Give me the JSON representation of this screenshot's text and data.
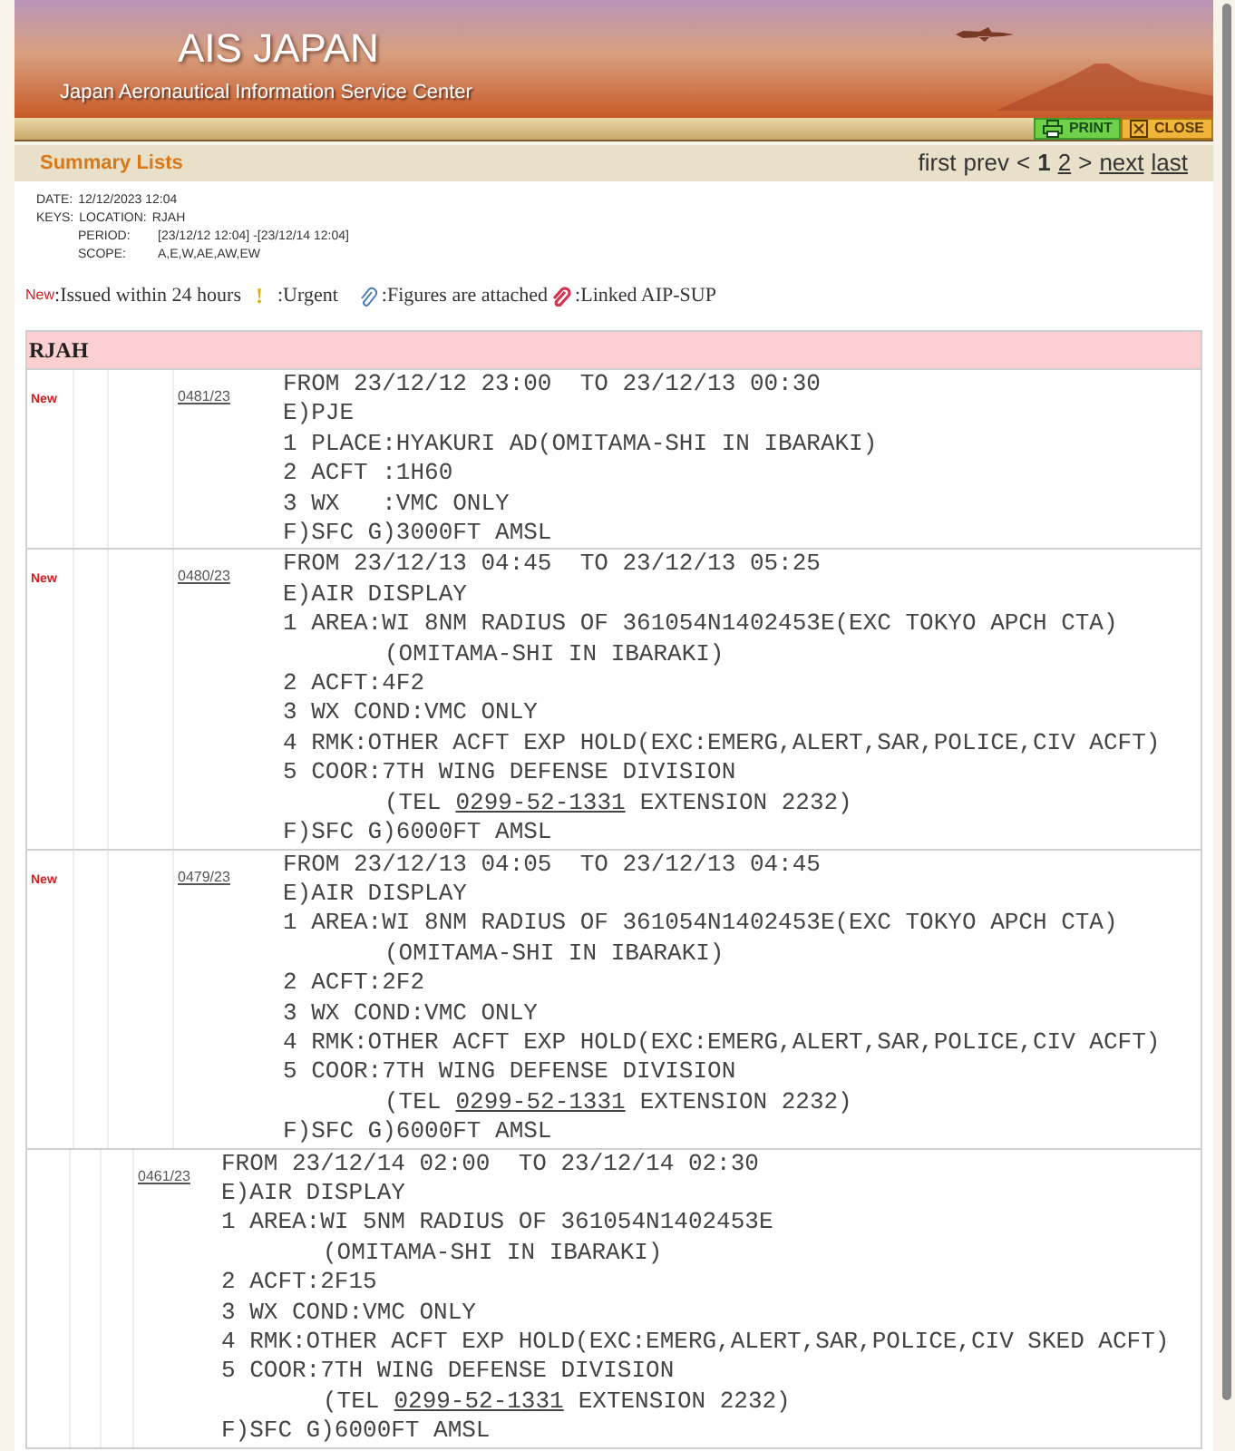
{
  "header": {
    "title": "AIS JAPAN",
    "subtitle": "Japan Aeronautical Information Service Center"
  },
  "toolbar": {
    "buttons": [
      {
        "label": "PRINT",
        "kind": "print"
      },
      {
        "label": "CLOSE",
        "kind": "close"
      }
    ]
  },
  "summary_bar": {
    "title": "Summary Lists",
    "pager": [
      {
        "label": "first",
        "kind": "text"
      },
      {
        "label": "prev",
        "kind": "text"
      },
      {
        "label": "<",
        "kind": "text"
      },
      {
        "label": "1",
        "kind": "current"
      },
      {
        "label": "2",
        "kind": "link"
      },
      {
        "label": ">",
        "kind": "text"
      },
      {
        "label": "next",
        "kind": "link"
      },
      {
        "label": "last",
        "kind": "link"
      }
    ]
  },
  "keys": {
    "date_label": "DATE:",
    "date": "12/12/2023 12:04",
    "keys_label": "KEYS:",
    "location_label": "LOCATION:",
    "location": "RJAH",
    "rows": [
      {
        "label": "PERIOD:",
        "value": "[23/12/12 12:04] -[23/12/14 12:04]"
      },
      {
        "label": "SCOPE:",
        "value": "A,E,W,AE,AW,EW"
      }
    ]
  },
  "legend": [
    {
      "kind": "new",
      "mark": "New",
      "text": ":Issued within 24 hours"
    },
    {
      "kind": "urgent",
      "mark": "!",
      "text": ":Urgent"
    },
    {
      "kind": "clip",
      "text": ":Figures are attached"
    },
    {
      "kind": "sup",
      "text": ":Linked AIP-SUP"
    }
  ],
  "group": {
    "title": "RJAH",
    "notices": [
      {
        "new": true,
        "new_label": "New",
        "number": "0481/23",
        "lines": [
          {
            "kind": "line",
            "text": "FROM 23/12/12 23:00  TO 23/12/13 00:30"
          },
          {
            "kind": "line",
            "text": "E)PJE"
          },
          {
            "kind": "line",
            "text": "1 PLACE:HYAKURI AD(OMITAMA-SHI IN IBARAKI)"
          },
          {
            "kind": "line",
            "text": "2 ACFT :1H60"
          },
          {
            "kind": "line",
            "text": "3 WX   :VMC ONLY"
          },
          {
            "kind": "line",
            "text": "F)SFC G)3000FT AMSL"
          }
        ]
      },
      {
        "new": true,
        "new_label": "New",
        "number": "0480/23",
        "lines": [
          {
            "kind": "line",
            "text": "FROM 23/12/13 04:45  TO 23/12/13 05:25"
          },
          {
            "kind": "line",
            "text": "E)AIR DISPLAY"
          },
          {
            "kind": "line",
            "text": "1 AREA:WI 8NM RADIUS OF 361054N1402453E(EXC TOKYO APCH CTA)"
          },
          {
            "kind": "continued",
            "text": "(OMITAMA-SHI IN IBARAKI)"
          },
          {
            "kind": "line",
            "text": "2 ACFT:4F2"
          },
          {
            "kind": "line",
            "text": "3 WX COND:VMC ONLY"
          },
          {
            "kind": "line",
            "text": "4 RMK:OTHER ACFT EXP HOLD(EXC:EMERG,ALERT,SAR,POLICE,CIV ACFT)"
          },
          {
            "kind": "line",
            "text": "5 COOR:7TH WING DEFENSE DIVISION"
          },
          {
            "kind": "phone",
            "before": "(TEL",
            "link": "0299-52-1331",
            "after": "EXTENSION 2232)"
          },
          {
            "kind": "line",
            "text": "F)SFC G)6000FT AMSL"
          }
        ]
      },
      {
        "new": true,
        "new_label": "New",
        "number": "0479/23",
        "lines": [
          {
            "kind": "line",
            "text": "FROM 23/12/13 04:05  TO 23/12/13 04:45"
          },
          {
            "kind": "line",
            "text": "E)AIR DISPLAY"
          },
          {
            "kind": "line",
            "text": "1 AREA:WI 8NM RADIUS OF 361054N1402453E(EXC TOKYO APCH CTA)"
          },
          {
            "kind": "continued",
            "text": "(OMITAMA-SHI IN IBARAKI)"
          },
          {
            "kind": "line",
            "text": "2 ACFT:2F2"
          },
          {
            "kind": "line",
            "text": "3 WX COND:VMC ONLY"
          },
          {
            "kind": "line",
            "text": "4 RMK:OTHER ACFT EXP HOLD(EXC:EMERG,ALERT,SAR,POLICE,CIV ACFT)"
          },
          {
            "kind": "line",
            "text": "5 COOR:7TH WING DEFENSE DIVISION"
          },
          {
            "kind": "phone",
            "before": "(TEL",
            "link": "0299-52-1331",
            "after": "EXTENSION 2232)"
          },
          {
            "kind": "line",
            "text": "F)SFC G)6000FT AMSL"
          }
        ]
      },
      {
        "new": false,
        "number": "0461/23",
        "lines": [
          {
            "kind": "line",
            "text": "FROM 23/12/14 02:00  TO 23/12/14 02:30"
          },
          {
            "kind": "line",
            "text": "E)AIR DISPLAY"
          },
          {
            "kind": "line",
            "text": "1 AREA:WI 5NM RADIUS OF 361054N1402453E"
          },
          {
            "kind": "continued",
            "text": "(OMITAMA-SHI IN IBARAKI)"
          },
          {
            "kind": "line",
            "text": "2 ACFT:2F15"
          },
          {
            "kind": "line",
            "text": "3 WX COND:VMC ONLY"
          },
          {
            "kind": "line",
            "text": "4 RMK:OTHER ACFT EXP HOLD(EXC:EMERG,ALERT,SAR,POLICE,CIV SKED ACFT)"
          },
          {
            "kind": "line",
            "text": "5 COOR:7TH WING DEFENSE DIVISION"
          },
          {
            "kind": "phone",
            "before": "(TEL",
            "link": "0299-52-1331",
            "after": "EXTENSION 2232)"
          },
          {
            "kind": "line",
            "text": "F)SFC G)6000FT AMSL"
          }
        ]
      }
    ]
  }
}
